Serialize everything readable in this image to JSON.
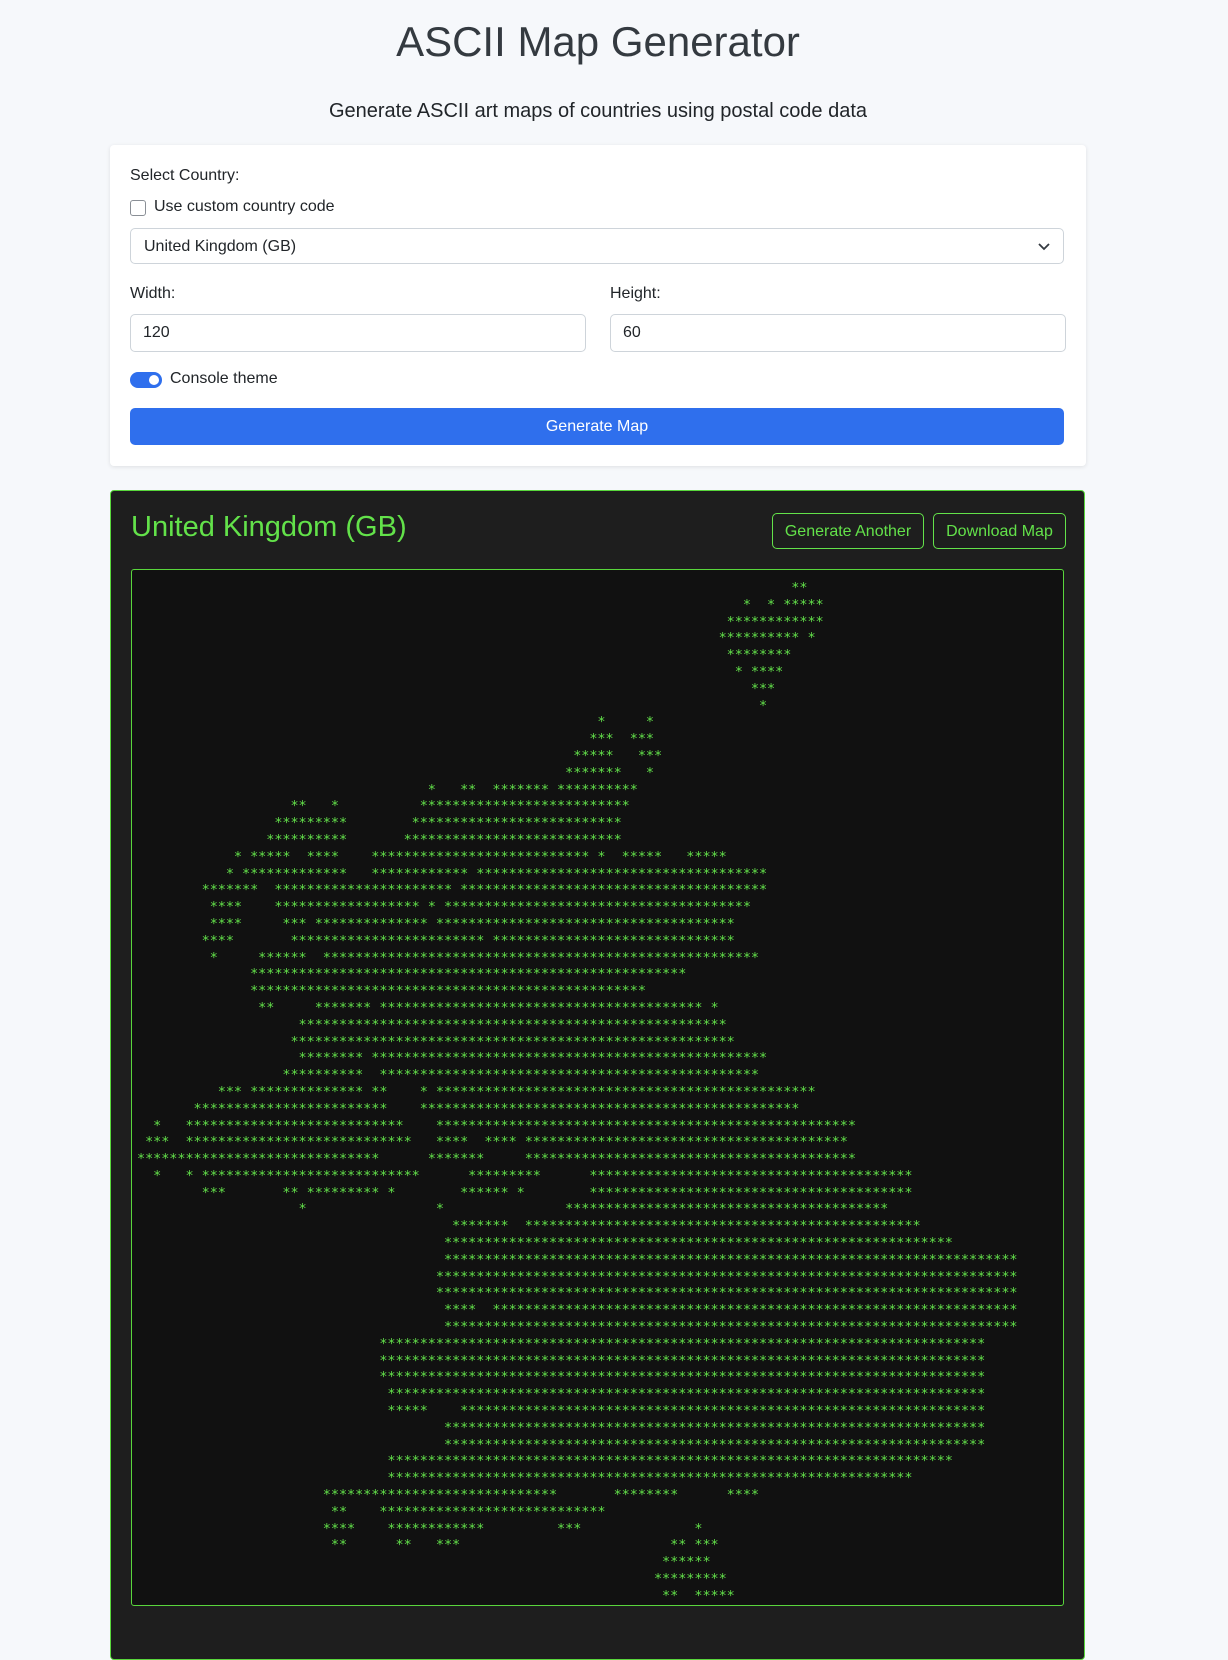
{
  "header": {
    "title": "ASCII Map Generator",
    "subtitle": "Generate ASCII art maps of countries using postal code data"
  },
  "form": {
    "select_country_label": "Select Country:",
    "custom_code_label": "Use custom country code",
    "custom_code_checked": false,
    "country_selected": "United Kingdom (GB)",
    "width_label": "Width:",
    "width_value": "120",
    "height_label": "Height:",
    "height_value": "60",
    "theme_label": "Console theme",
    "theme_on": true,
    "generate_label": "Generate Map"
  },
  "output": {
    "title": "United Kingdom (GB)",
    "generate_another_label": "Generate Another",
    "download_label": "Download Map",
    "ascii_art": "                                                                                 **\n                                                                           *  * *****\n                                                                         ************\n                                                                        ********** *\n                                                                         ********\n                                                                          * ****\n                                                                            ***\n                                                                             *\n                                                         *     *\n                                                        ***  ***\n                                                      *****   ***\n                                                     *******   *\n                                    *   **  ******* **********\n                   **   *          **************************\n                 *********        **************************\n                **********       ***************************\n            * *****  ****    *************************** *  *****   *****\n           * *************   ************ ************************************\n        *******  ********************** **************************************\n         ****    ****************** * **************************************\n         ****     *** ************** *************************************\n        ****       ************************ ******************************\n         *     ******  ******************************************************\n              ******************************************************\n              *************************************************\n               **     ******* **************************************** *\n                    *****************************************************\n                   *******************************************************\n                    ******** *************************************************\n                  **********  ***********************************************\n          *** ************** **    * ***********************************************\n       ************************    ***********************************************\n  *   ***************************    ****************************************************\n ***  ****************************   ****  **** ****************************************\n******************************      *******     *****************************************\n  *   * ***************************      *********      ****************************************\n        ***       ** ********* *        ****** *        ****************************************\n                    *                *               ****************************************\n                                       *******  *************************************************\n                                      ***************************************************************\n                                      ***********************************************************************\n                                     ************************************************************************\n                                     ************************************************************************\n                                      ****  *****************************************************************\n                                      ***********************************************************************\n                              ***************************************************************************\n                              ***************************************************************************\n                              ***************************************************************************\n                               **************************************************************************\n                               *****    *****************************************************************\n                                      *******************************************************************\n                                      *******************************************************************\n                               **********************************************************************\n                               *****************************************************************\n                       *****************************       ********      ****\n                        **    ****************************\n                       ****    ************         ***              *\n                        **      **   ***                          ** ***\n                                                                 ******\n                                                                *********\n                                                                 **  *****"
  },
  "theme": {
    "accent": "#2f6fed",
    "console_green": "#63e24a",
    "console_bg": "#1e1e1e"
  }
}
